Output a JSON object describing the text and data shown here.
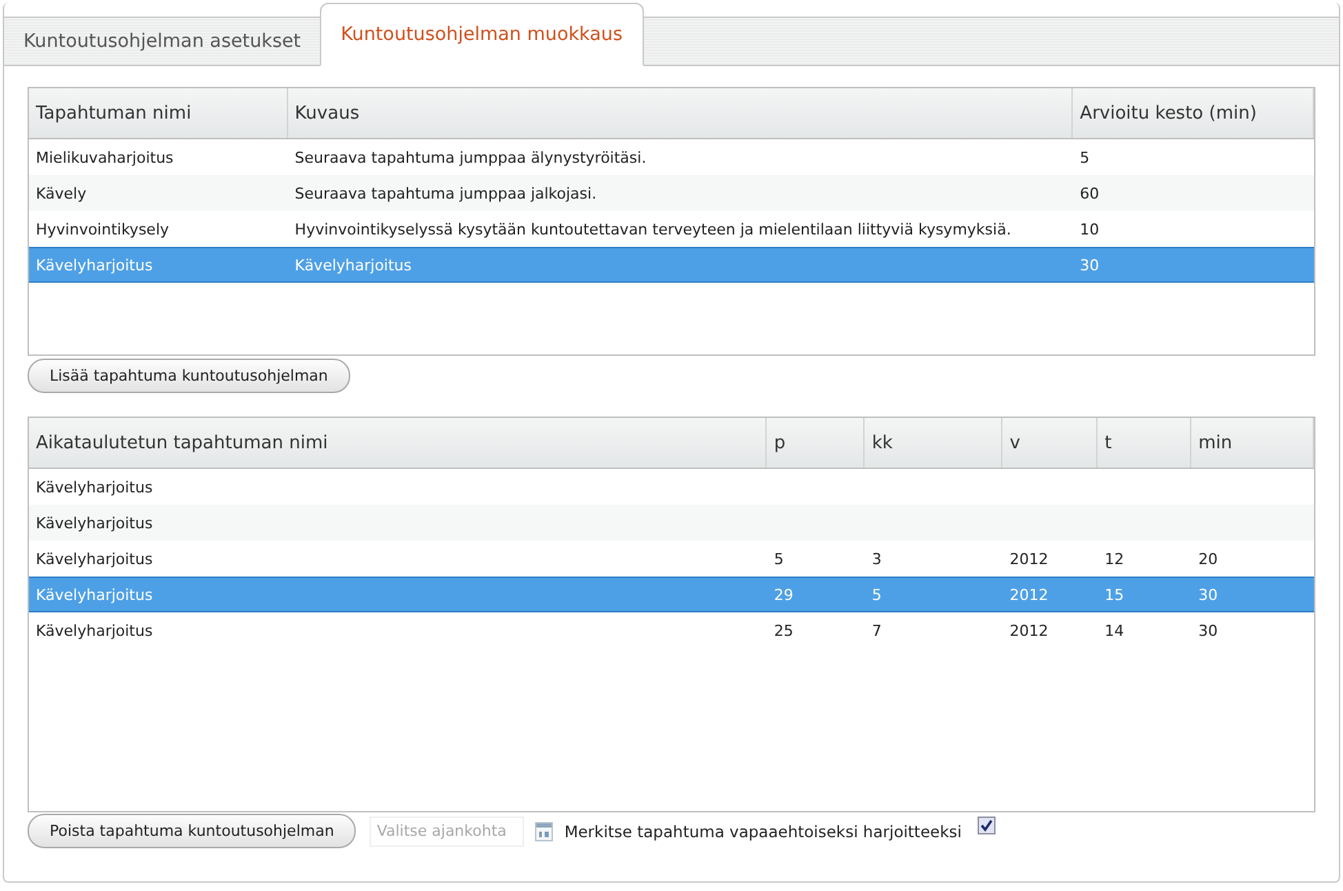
{
  "tabs": [
    {
      "label": "Kuntoutusohjelman asetukset",
      "selected": false
    },
    {
      "label": "Kuntoutusohjelman muokkaus",
      "selected": true
    }
  ],
  "events_table": {
    "columns": [
      "Tapahtuman nimi",
      "Kuvaus",
      "Arvioitu kesto (min)"
    ],
    "rows": [
      {
        "cells": [
          "Mielikuvaharjoitus",
          "Seuraava tapahtuma jumppaa älynystyröitäsi.",
          "5"
        ],
        "selected": false
      },
      {
        "cells": [
          "Kävely",
          "Seuraava tapahtuma jumppaa jalkojasi.",
          "60"
        ],
        "selected": false
      },
      {
        "cells": [
          "Hyvinvointikysely",
          "Hyvinvointikyselyssä kysytään kuntoutettavan terveyteen ja mielentilaan liittyviä kysymyksiä.",
          "10"
        ],
        "selected": false
      },
      {
        "cells": [
          "Kävelyharjoitus",
          "Kävelyharjoitus",
          "30"
        ],
        "selected": true
      }
    ]
  },
  "add_button": "Lisää tapahtuma kuntoutusohjelman",
  "schedule_table": {
    "columns": [
      "Aikataulutetun tapahtuman nimi",
      "p",
      "kk",
      "v",
      "t",
      "min"
    ],
    "rows": [
      {
        "cells": [
          "Kävelyharjoitus"
        ],
        "selected": false
      },
      {
        "cells": [
          "Kävelyharjoitus"
        ],
        "selected": false
      },
      {
        "cells": [
          "Kävelyharjoitus",
          "5",
          "3",
          "2012",
          "12",
          "20"
        ],
        "selected": false
      },
      {
        "cells": [
          "Kävelyharjoitus",
          "29",
          "5",
          "2012",
          "15",
          "30"
        ],
        "selected": true
      },
      {
        "cells": [
          "Kävelyharjoitus",
          "25",
          "7",
          "2012",
          "14",
          "30"
        ],
        "selected": false
      }
    ]
  },
  "remove_button": "Poista tapahtuma kuntoutusohjelman",
  "date_field": {
    "placeholder": "Valitse ajankohta",
    "disabled": true
  },
  "optional_checkbox": {
    "label": "Merkitse tapahtuma vapaaehtoiseksi harjoitteeksi",
    "checked": true
  }
}
